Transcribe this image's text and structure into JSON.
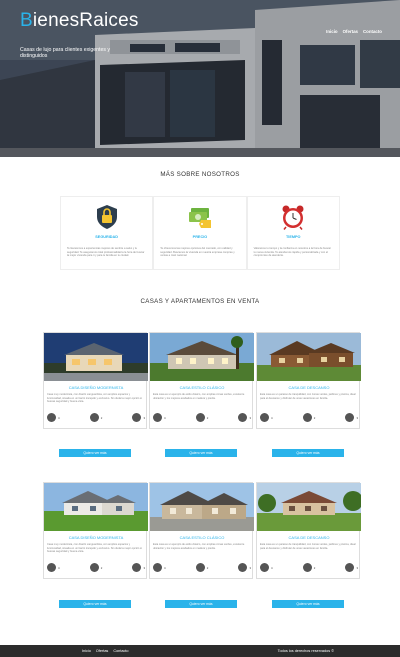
{
  "header": {
    "logo_first": "B",
    "logo_rest": "ienesRaices",
    "tagline": "Casas de lujo para clientes exigentes y distinguidos",
    "nav": [
      "Inicio",
      "Ofertas",
      "Contacto"
    ]
  },
  "about": {
    "title": "MÁS SOBRE NOSOTROS",
    "features": [
      {
        "icon": "lock-shield-icon",
        "title": "SEGURIDAD",
        "text": "Te llevaremos a experiencias mejores de sentirte a salvo y tu seguridad. Te aseguramos total profesionalidad a la hora de buscar la mejor vivienda para ti y para tu familia en tu ciudad."
      },
      {
        "icon": "money-tag-icon",
        "title": "PRECIO",
        "text": "Te ofrecemos las mejores opciones del mercado, con calidad y seguridad. Buscamos la vivienda en nuestra empresa compras y ventas a nivel nacional."
      },
      {
        "icon": "alarm-clock-icon",
        "title": "TIEMPO",
        "text": "Valoramos tu tiempo y la confianza en nosotros a la hora de buscar tu nueva vivienda. Te atendemos rápida y personalizada y con el compromiso de atenderte."
      }
    ]
  },
  "listings": {
    "title": "CASAS Y APARTAMENTOS EN VENTA",
    "button_label": "Quiero ver más",
    "cards": [
      {
        "title": "CASA DISEÑO MODERNISTA",
        "text": "Casa muy modernista, con diseño vanguardista, con amplios espacios y luminosidad, situada en un barrio tranquilo y exclusivo. Sin duda la mejor opción si buscas seguridad y buena vista.",
        "stats": [
          "4",
          "2",
          "3"
        ]
      },
      {
        "title": "CASA ESTILO CLÁSICO",
        "text": "Esta casa es un ejemplo de estilo clásico, con amplias zonas verdes, excelente ubicación y los mejores acabados en madera y piedra.",
        "stats": [
          "4",
          "2",
          "3"
        ]
      },
      {
        "title": "CASA DE DESCANSO",
        "text": "Esta casa es un paraíso de tranquilidad, con zonas verdes, jardines y piscina, ideal para el descanso y disfrutar de unas vacaciones en familia.",
        "stats": [
          "4",
          "2",
          "3"
        ]
      },
      {
        "title": "CASA DISEÑO MODERNISTA",
        "text": "Casa muy modernista, con diseño vanguardista, con amplios espacios y luminosidad, situada en un barrio tranquilo y exclusivo. Sin duda la mejor opción si buscas seguridad y buena vista.",
        "stats": [
          "4",
          "2",
          "3"
        ]
      },
      {
        "title": "CASA ESTILO CLÁSICO",
        "text": "Esta casa es un ejemplo de estilo clásico, con amplias zonas verdes, excelente ubicación y los mejores acabados en madera y piedra.",
        "stats": [
          "4",
          "2",
          "3"
        ]
      },
      {
        "title": "CASA DE DESCANSO",
        "text": "Esta casa es un paraíso de tranquilidad, con zonas verdes, jardines y piscina, ideal para el descanso y disfrutar de unas vacaciones en familia.",
        "stats": [
          "4",
          "2",
          "3"
        ]
      }
    ]
  },
  "footer": {
    "nav": [
      "Inicio",
      "Ofertas",
      "Contacto"
    ],
    "copyright": "Todos los derechos reservados ©"
  },
  "colors": {
    "accent": "#2ab3ea",
    "footer": "#2c2c2c"
  }
}
